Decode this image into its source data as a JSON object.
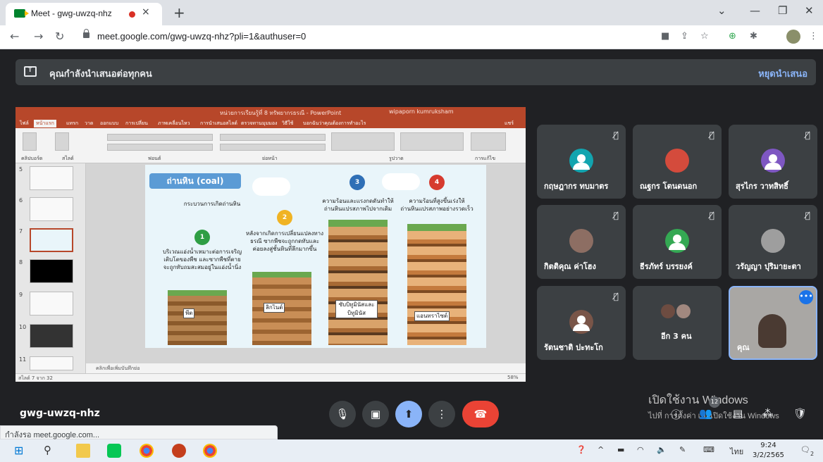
{
  "browser": {
    "tab_title": "Meet - gwg-uwzq-nhz",
    "tab_close": "×",
    "new_tab": "+",
    "url": "meet.google.com/gwg-uwzq-nhz?pli=1&authuser=0",
    "status_text": "กำลังรอ meet.google.com..."
  },
  "meet": {
    "presenting_label": "คุณกำลังนำเสนอต่อทุกคน",
    "stop_presenting": "หยุดนำเสนอ",
    "meeting_code": "gwg-uwzq-nhz",
    "participant_count": "12",
    "participants": [
      {
        "name": "กฤษฎากร ทบมาตร",
        "avatar_color": "#12a4af"
      },
      {
        "name": "ณฐกร โตนดนอก",
        "avatar_color": "#d44b3c"
      },
      {
        "name": "สุรไกร วาทสิทธิ์",
        "avatar_color": "#7e57c2"
      },
      {
        "name": "กิตติคุณ ค่าโฮง",
        "avatar_color": "#8d6e63"
      },
      {
        "name": "ธีรภัทร์ บรรยงค์",
        "avatar_color": "#34a853"
      },
      {
        "name": "วรัญญา ปุริมายะตา",
        "avatar_color": "#9e9e9e"
      },
      {
        "name": "รัตนชาติ ปะทะโก",
        "avatar_color": "#795548"
      },
      {
        "name": "อีก 3 คน",
        "avatar_color": ""
      },
      {
        "name": "คุณ",
        "avatar_color": ""
      }
    ]
  },
  "slide": {
    "title": "ถ่านหิน (coal)",
    "subtitle": "กระบวนการเกิดถ่านหิน",
    "steps": [
      {
        "num": "1",
        "color": "#2e9e44",
        "text": "บริเวณแอ่งน้ำเหมาะต่อการเจริญเติบโตของพืช และซากพืชที่ตายจะถูกทับถมสะสมอยู่ในแอ่งน้ำนิ่ง",
        "tag": "พีต"
      },
      {
        "num": "2",
        "color": "#f0b323",
        "text": "หลังจากเกิดการเปลี่ยนแปลงทางธรณี ซากพืชจะถูกกดทับและค่อยลงสู่ชั้นหินที่ลึกมากขึ้น",
        "tag": "ลิกไนต์"
      },
      {
        "num": "3",
        "color": "#2f6fb6",
        "text": "ความร้อนและแรงกดดันทำให้ถ่านหินแปรสภาพไปจากเดิม",
        "tag": "ซับบิทูมินัสและบิทูมินัส"
      },
      {
        "num": "4",
        "color": "#d63b2f",
        "text": "ความร้อนที่สูงขึ้นเร่งให้ถ่านหินแปรสภาพอย่างรวดเร็ว",
        "tag": "แอนทราไซต์"
      }
    ],
    "notes_placeholder": "คลิกเพื่อเพิ่มบันทึกย่อ",
    "status_left": "สไลด์ 7 จาก 32",
    "status_zoom": "58%"
  },
  "powerpoint": {
    "title": "หน่วยการเรียนรู้ที่ 8 ทรัพยากรธรณี - PowerPoint",
    "user": "wipaporn kumruksham",
    "menu": [
      "ไฟล์",
      "หน้าแรก",
      "แทรก",
      "วาด",
      "ออกแบบ",
      "การเปลี่ยน",
      "ภาพเคลื่อนไหว",
      "การนำเสนอสไลด์",
      "ตรวจทาน",
      "มุมมอง",
      "วิธีใช้",
      "บอกฉันว่าคุณต้องการทำอะไร",
      "แชร์"
    ],
    "ribbon_groups": [
      "คลิปบอร์ด",
      "สไลด์",
      "ฟอนต์",
      "ย่อหน้า",
      "รูปวาด",
      "การแก้ไข"
    ],
    "slide_numbers": [
      "5",
      "6",
      "7",
      "8",
      "9",
      "10",
      "11"
    ]
  },
  "windows": {
    "activate_title": "เปิดใช้งาน Windows",
    "activate_sub": "ไปที่ การตั้งค่า เพื่อเปิดใช้งาน Windows",
    "time": "9:24",
    "date": "3/2/2565",
    "lang": "ไทย",
    "notif_count": "2"
  }
}
